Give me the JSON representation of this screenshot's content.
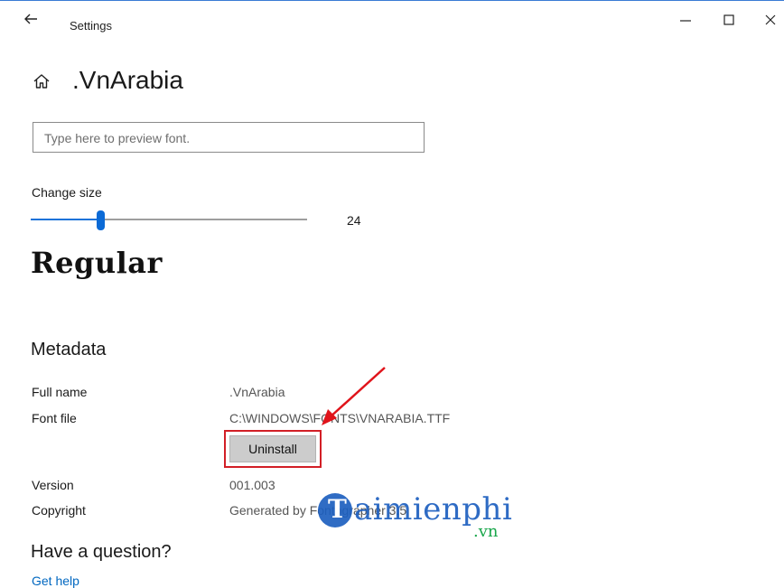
{
  "window": {
    "title": "Settings"
  },
  "page": {
    "title": ".VnArabia"
  },
  "preview": {
    "placeholder": "Type here to preview font."
  },
  "size": {
    "label": "Change size",
    "value": "24",
    "slider_fraction": 0.25
  },
  "sample": {
    "text": "Regular"
  },
  "metadata": {
    "heading": "Metadata",
    "full_name_label": "Full name",
    "full_name_value": ".VnArabia",
    "font_file_label": "Font file",
    "font_file_value": "C:\\WINDOWS\\FONTS\\VNARABIA.TTF",
    "uninstall_label": "Uninstall",
    "version_label": "Version",
    "version_value": "001.003",
    "copyright_label": "Copyright",
    "copyright_value": "Generated by Fontographer 3.5"
  },
  "help": {
    "heading": "Have a question?",
    "link": "Get help"
  },
  "watermark": {
    "brand": "aimienphi",
    "tld": ".vn"
  },
  "colors": {
    "accent": "#0b6ad6",
    "highlight": "#d21f26",
    "link": "#0067c0"
  },
  "icons": [
    "back-arrow-icon",
    "minimize-icon",
    "maximize-icon",
    "close-icon",
    "home-icon",
    "red-arrow-annotation"
  ]
}
